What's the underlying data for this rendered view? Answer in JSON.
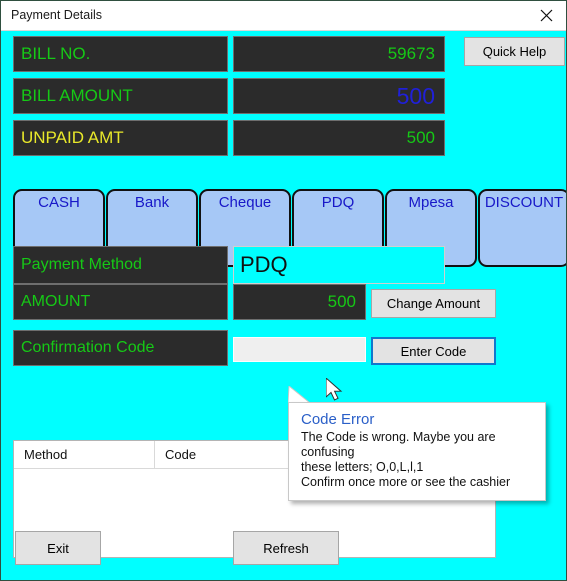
{
  "window": {
    "title": "Payment Details",
    "close_icon": "close-icon",
    "background_color": "#00ffff"
  },
  "quick_help": {
    "label": "Quick Help"
  },
  "fields": [
    {
      "label": "BILL NO.",
      "label_color": "#16c916",
      "value": "59673",
      "value_color": "#16c916",
      "value_size": "small"
    },
    {
      "label": "BILL AMOUNT",
      "label_color": "#16c916",
      "value": "500",
      "value_color": "#2020d8",
      "value_size": "large"
    },
    {
      "label": "UNPAID AMT",
      "label_color": "#e8e82a",
      "value": "500",
      "value_color": "#16c916",
      "value_size": "small"
    }
  ],
  "payment_methods": [
    {
      "label": "CASH"
    },
    {
      "label": "Bank"
    },
    {
      "label": "Cheque"
    },
    {
      "label": "PDQ"
    },
    {
      "label": "Mpesa"
    },
    {
      "label": "DISCOUNT"
    }
  ],
  "payment_method_row": {
    "label": "Payment Method",
    "value": "PDQ"
  },
  "amount_row": {
    "label": "AMOUNT",
    "value": "500",
    "button_label": "Change Amount"
  },
  "confirmation_row": {
    "label": "Confirmation Code",
    "value": "",
    "placeholder": "",
    "button_label": "Enter Code"
  },
  "tooltip": {
    "title": "Code Error",
    "line1": "The Code is wrong. Maybe you are confusing",
    "line2": "these letters; O,0,L,l,1",
    "line3": "Confirm once more or see the cashier"
  },
  "table": {
    "columns": [
      "Method",
      "Code"
    ],
    "rows": []
  },
  "footer": {
    "exit_label": "Exit",
    "refresh_label": "Refresh"
  }
}
